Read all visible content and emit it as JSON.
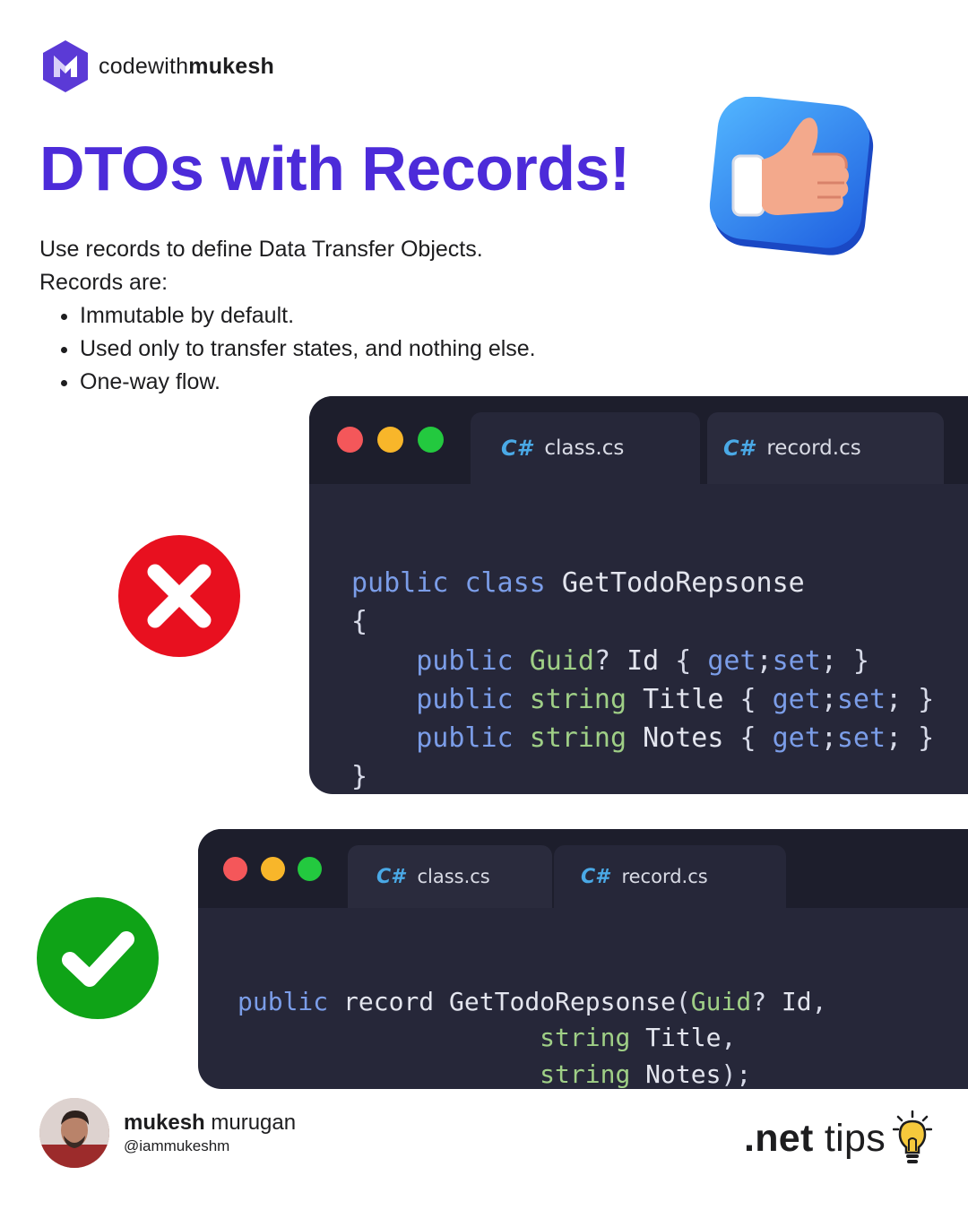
{
  "brand": {
    "name_regular": "codewith",
    "name_bold": "mukesh",
    "logo_icon": "hexagon-m-logo-icon",
    "color": "#5b3ad6"
  },
  "title": "DTOs with Records!",
  "title_color": "#4c2bd9",
  "intro": {
    "line1": "Use records to define Data Transfer Objects.",
    "line2": "Records are:",
    "bullets": [
      "Immutable by default.",
      "Used only to transfer states, and nothing else.",
      "One-way flow."
    ]
  },
  "decorations": {
    "thumb": "thumbs-up-icon",
    "wrong": "x-circle-icon",
    "right": "check-circle-icon",
    "bulb": "lightbulb-icon",
    "wrong_color": "#e8101f",
    "right_color": "#0fa317"
  },
  "windows": [
    {
      "tabs": [
        {
          "icon": "C#",
          "label": "class.cs",
          "active": true
        },
        {
          "icon": "C#",
          "label": "record.cs",
          "active": false
        }
      ],
      "code": {
        "l1": {
          "a": "public",
          "b": "class",
          "c": "GetTodoRepsonse"
        },
        "l2": "{",
        "rows": [
          {
            "mod": "public",
            "type": "Guid",
            "q": "?",
            "name": "Id",
            "open": "{",
            "get": "get",
            "semi": ";",
            "set": "set",
            "close": "; }"
          },
          {
            "mod": "public",
            "type": "string",
            "q": "",
            "name": "Title",
            "open": "{",
            "get": "get",
            "semi": ";",
            "set": "set",
            "close": "; }"
          },
          {
            "mod": "public",
            "type": "string",
            "q": "",
            "name": "Notes",
            "open": "{",
            "get": "get",
            "semi": ";",
            "set": "set",
            "close": "; }"
          }
        ],
        "l6": "}"
      }
    },
    {
      "tabs": [
        {
          "icon": "C#",
          "label": "class.cs",
          "active": false
        },
        {
          "icon": "C#",
          "label": "record.cs",
          "active": true
        }
      ],
      "code": {
        "l1": {
          "a": "public",
          "b": "record",
          "c": "GetTodoRepsonse",
          "p": "(",
          "t": "Guid",
          "q": "?",
          "n": "Id",
          "e": ","
        },
        "l2": {
          "t": "string",
          "n": "Title",
          "e": ","
        },
        "l3": {
          "t": "string",
          "n": "Notes",
          "e": ");"
        }
      }
    }
  ],
  "author": {
    "name_bold": "mukesh",
    "name_regular": "murugan",
    "handle": "@iammukeshm"
  },
  "footer": {
    "tag_bold": ".net",
    "tag_regular": "tips"
  }
}
